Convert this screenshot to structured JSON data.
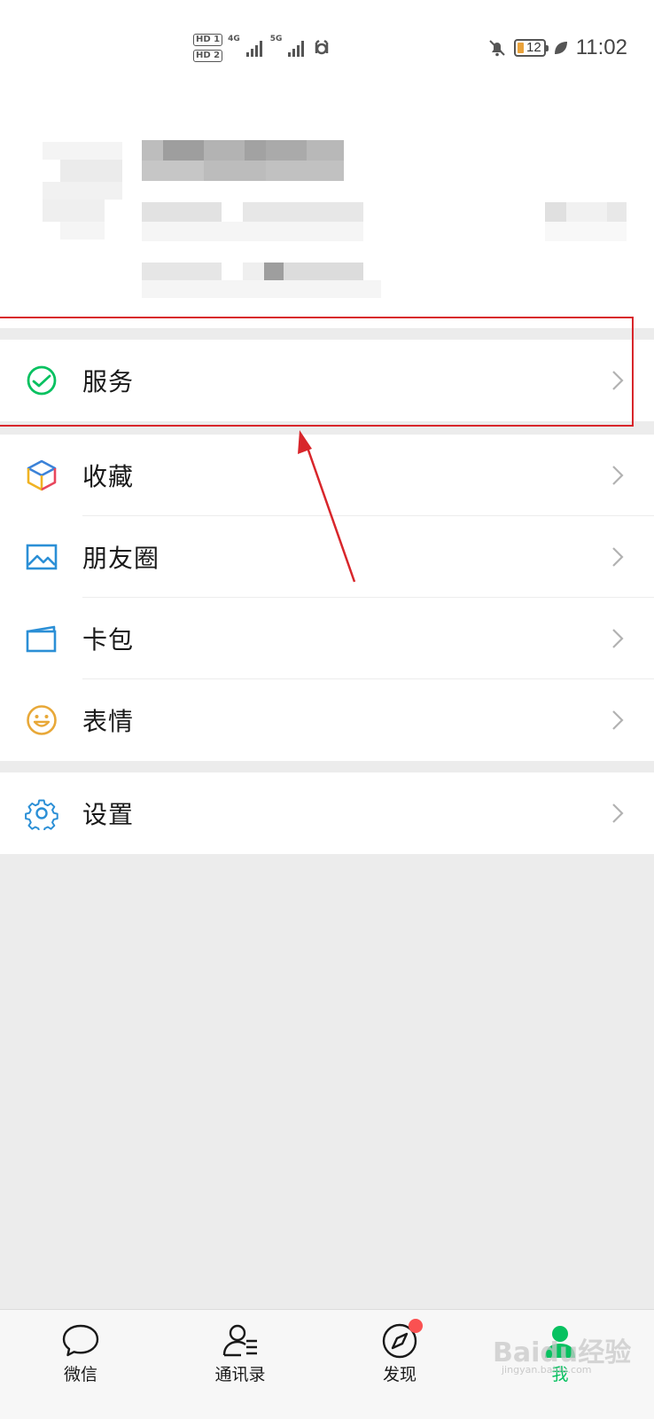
{
  "status_bar": {
    "hd1": "HD 1",
    "hd2": "HD 2",
    "net1": "4G",
    "net2": "5G",
    "battery": "12",
    "time": "11:02"
  },
  "menu": {
    "services": "服务",
    "favorites": "收藏",
    "moments": "朋友圈",
    "cards": "卡包",
    "stickers": "表情",
    "settings": "设置"
  },
  "tabs": [
    {
      "label": "微信",
      "icon": "chat-icon"
    },
    {
      "label": "通讯录",
      "icon": "contacts-icon"
    },
    {
      "label": "发现",
      "icon": "compass-icon"
    },
    {
      "label": "我",
      "icon": "me-icon"
    }
  ],
  "watermark": {
    "text": "Baidu经验",
    "sub": "jingyan.baidu.com"
  },
  "colors": {
    "accent": "#07c160",
    "annotation": "#d8262b",
    "badge": "#fa5151"
  }
}
